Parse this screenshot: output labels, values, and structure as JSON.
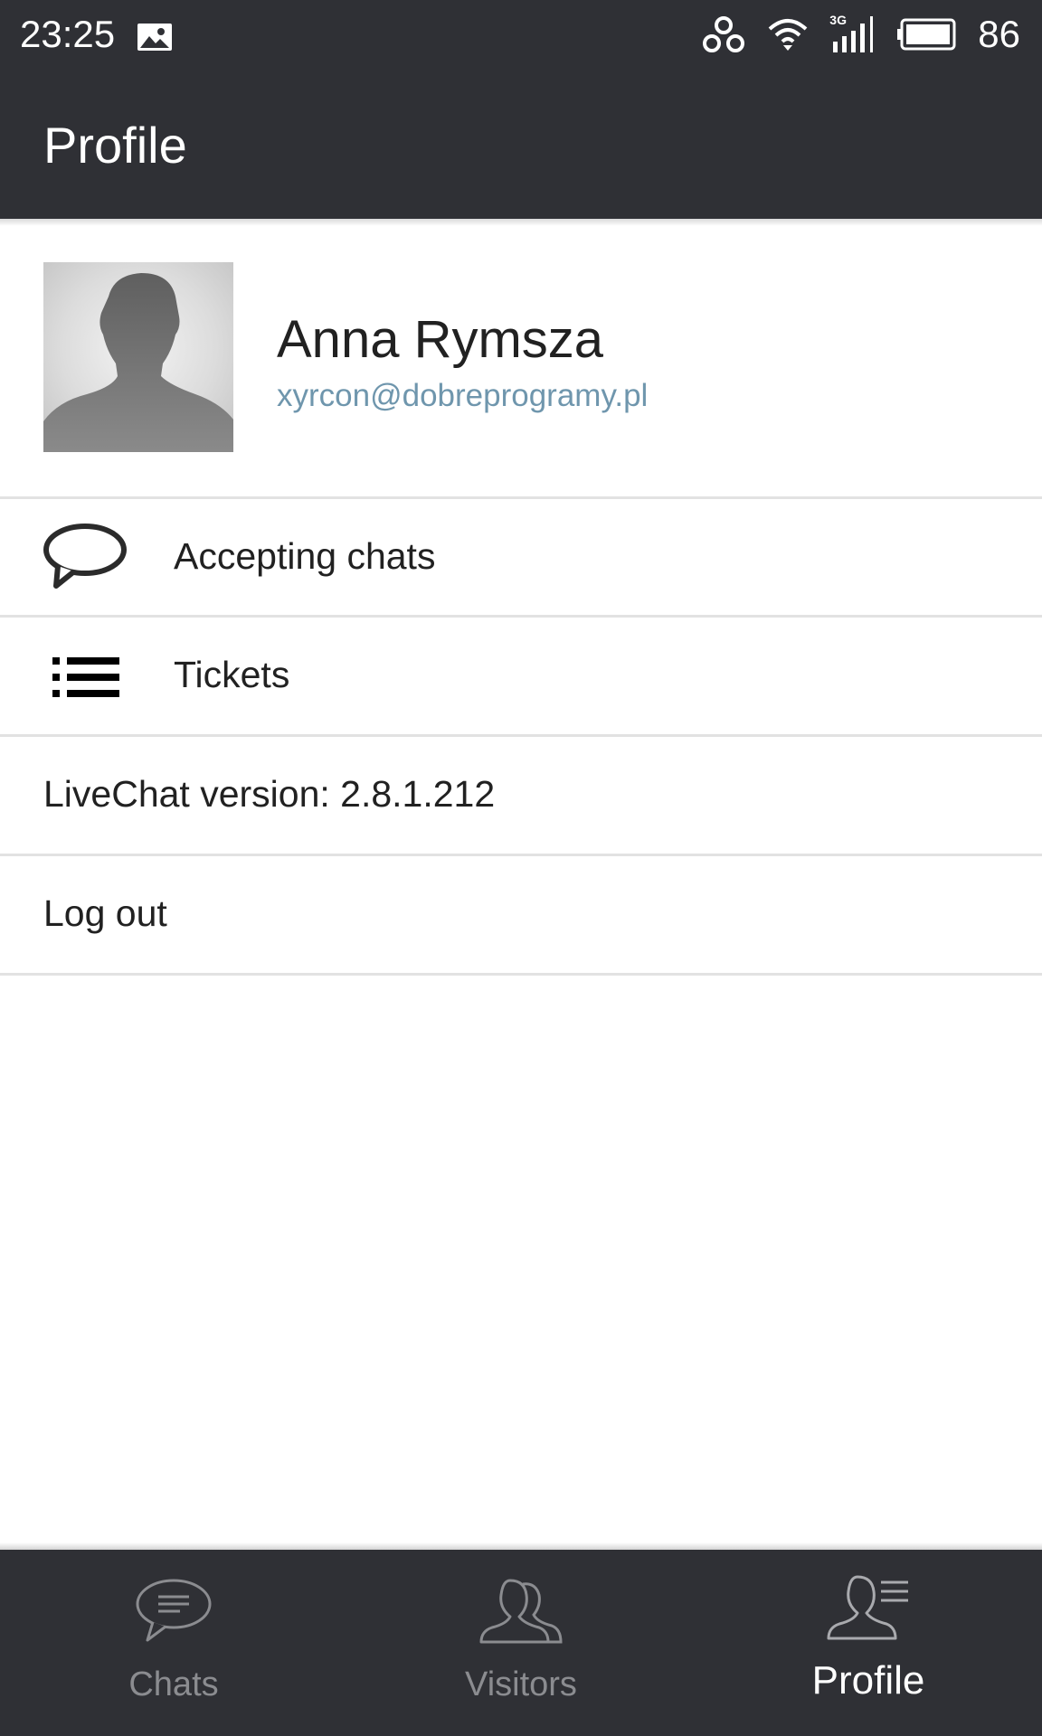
{
  "status_bar": {
    "time": "23:25",
    "battery_level": "86",
    "network_type": "3G",
    "icons": [
      "image-icon",
      "vpn-icon",
      "wifi-icon",
      "signal-icon",
      "battery-icon"
    ]
  },
  "app_bar": {
    "title": "Profile"
  },
  "profile": {
    "name": "Anna Rymsza",
    "email": "xyrcon@dobreprogramy.pl",
    "avatar": "default-silhouette"
  },
  "menu": {
    "accepting_chats": {
      "label": "Accepting chats",
      "icon": "chat-bubble-icon"
    },
    "tickets": {
      "label": "Tickets",
      "icon": "list-icon"
    },
    "version": "LiveChat version: 2.8.1.212",
    "logout": "Log out"
  },
  "bottom_nav": {
    "items": [
      {
        "label": "Chats",
        "icon": "chats-icon",
        "active": false
      },
      {
        "label": "Visitors",
        "icon": "visitors-icon",
        "active": false
      },
      {
        "label": "Profile",
        "icon": "profile-icon",
        "active": true
      }
    ]
  },
  "colors": {
    "bar_background": "#2f3035",
    "email_accent": "#6f96ad",
    "inactive_nav": "#8b8c90"
  }
}
